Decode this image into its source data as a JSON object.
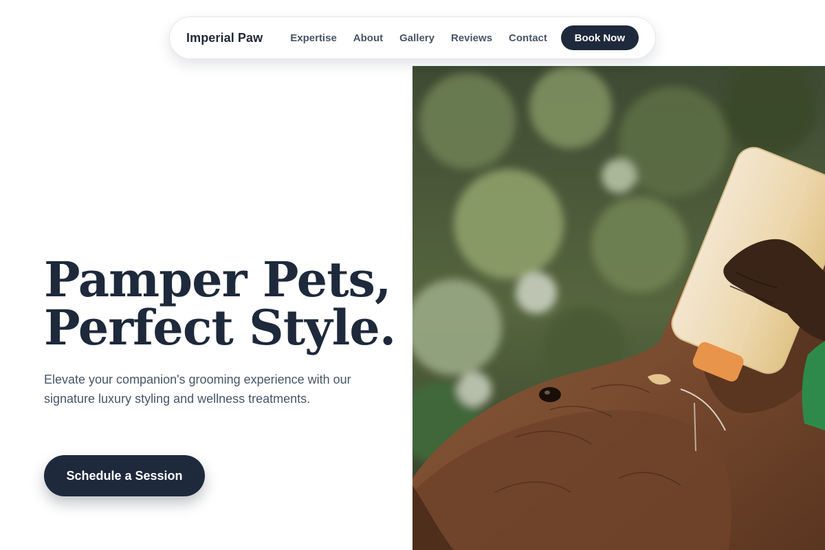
{
  "nav": {
    "brand": "Imperial Paw",
    "links": [
      {
        "label": "Expertise"
      },
      {
        "label": "About"
      },
      {
        "label": "Gallery"
      },
      {
        "label": "Reviews"
      },
      {
        "label": "Contact"
      }
    ],
    "cta_label": "Book Now"
  },
  "hero": {
    "title_line1": "Pamper Pets,",
    "title_line2": "Perfect Style.",
    "subtitle": "Elevate your companion's grooming experience with our signature luxury styling and wellness treatments.",
    "cta_label": "Schedule a Session"
  },
  "colors": {
    "primary": "#1e293b",
    "text_muted": "#475569",
    "background": "#ffffff"
  }
}
